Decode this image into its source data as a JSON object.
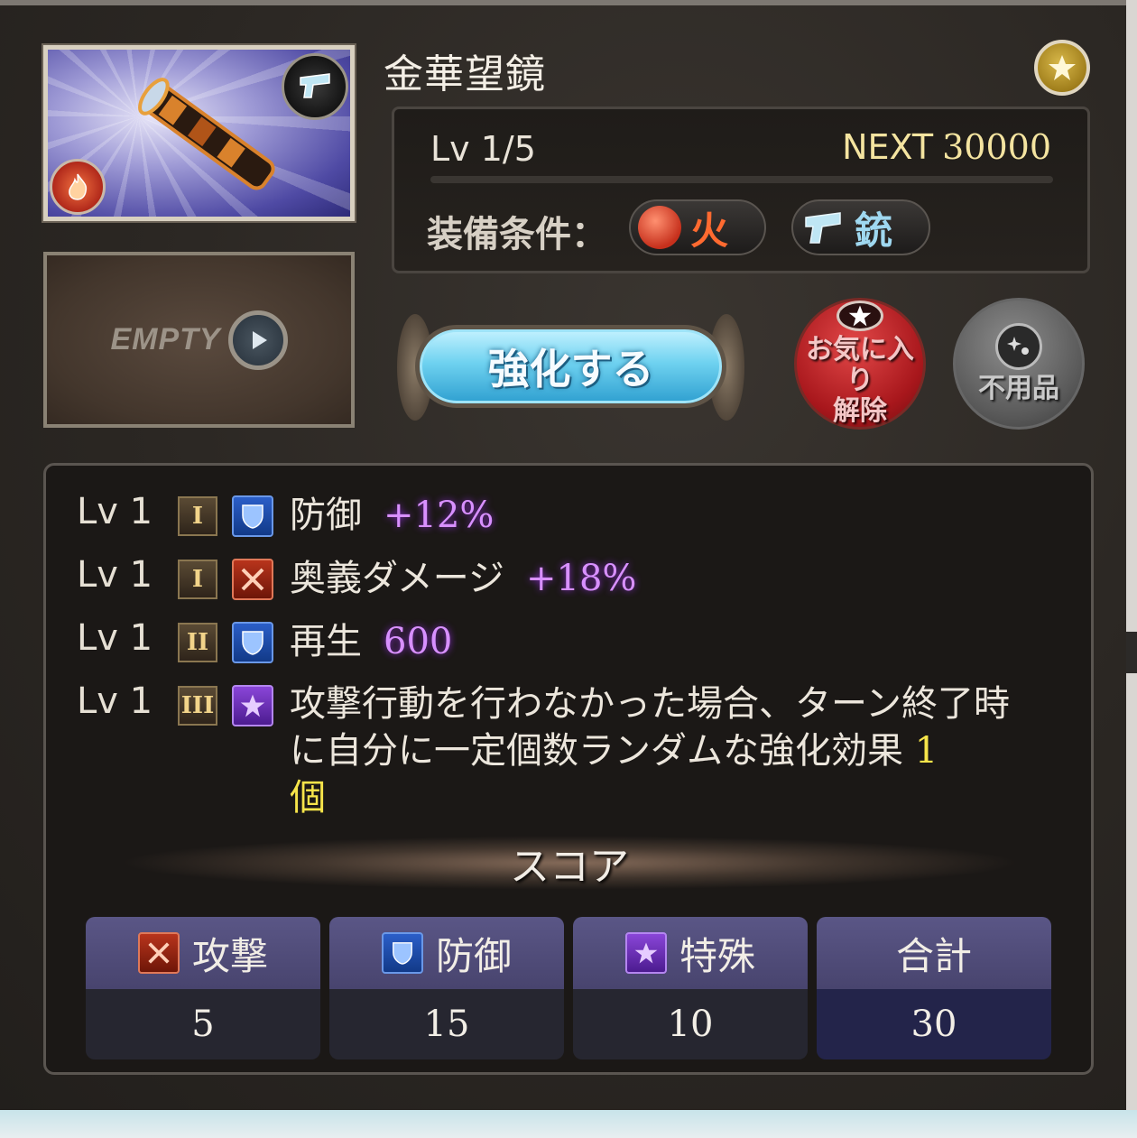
{
  "weapon": {
    "name": "金華望鏡",
    "level": "Lv 1/5",
    "next_label": "NEXT",
    "next_value": "30000",
    "equip_label": "装備条件：",
    "element": "火",
    "weapon_type": "銃",
    "empty_slot_label": "EMPTY"
  },
  "actions": {
    "enhance_label": "強化する",
    "unfavorite_label_line1": "お気に入り",
    "unfavorite_label_line2": "解除",
    "junk_label": "不用品"
  },
  "skills": [
    {
      "lv": "Lv 1",
      "rank": "I",
      "icon": "shield-icon",
      "name": "防御",
      "value": "+12%"
    },
    {
      "lv": "Lv 1",
      "rank": "I",
      "icon": "crossed-swords-icon",
      "name": "奥義ダメージ",
      "value": "+18%"
    },
    {
      "lv": "Lv 1",
      "rank": "II",
      "icon": "shield-icon",
      "name": "再生",
      "value": "600"
    },
    {
      "lv": "Lv 1",
      "rank": "III",
      "icon": "star-icon",
      "desc": "攻撃行動を行わなかった場合、ターン終了時に自分に一定個数ランダムな強化効果",
      "value": "1",
      "unit": "個"
    }
  ],
  "score": {
    "title": "スコア",
    "cells": [
      {
        "label": "攻撃",
        "icon": "crossed-swords-icon",
        "value": "5"
      },
      {
        "label": "防御",
        "icon": "shield-icon",
        "value": "15"
      },
      {
        "label": "特殊",
        "icon": "star-icon",
        "value": "10"
      },
      {
        "label": "合計",
        "value": "30"
      }
    ]
  },
  "colors": {
    "accent_purple": "#d890ff",
    "highlight_yellow": "#f6e44a",
    "fire_red": "#ff6a30"
  }
}
